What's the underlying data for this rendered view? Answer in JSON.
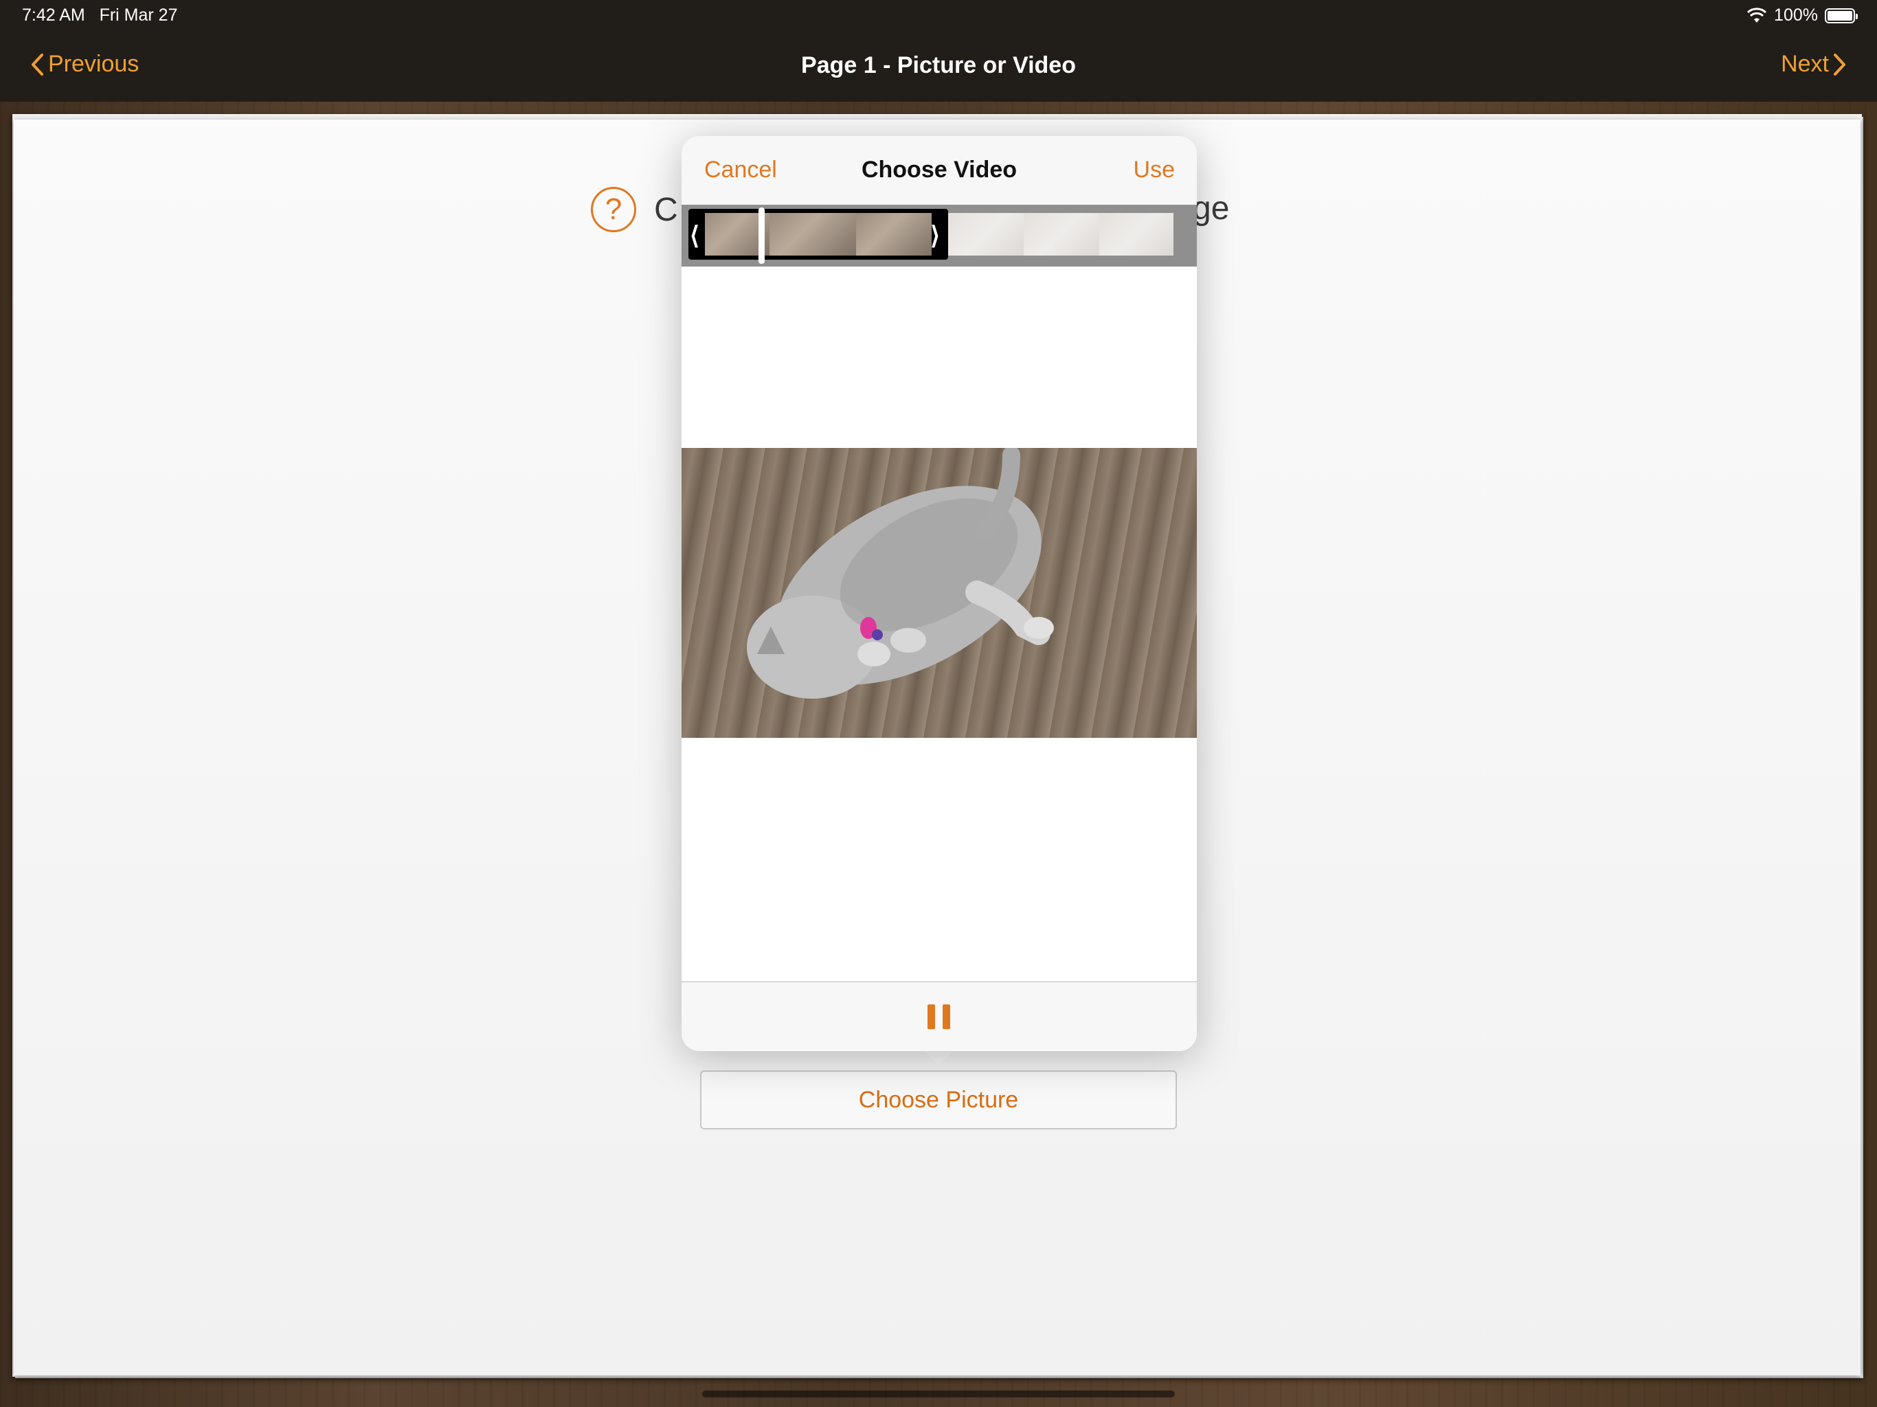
{
  "status_bar": {
    "time": "7:42 AM",
    "date": "Fri Mar 27",
    "battery": "100%"
  },
  "nav": {
    "previous_label": "Previous",
    "title": "Page 1 - Picture or Video",
    "next_label": "Next"
  },
  "page": {
    "help_text_start": "C",
    "help_text_end": "ge",
    "choose_picture_label": "Choose Picture"
  },
  "popover": {
    "cancel_label": "Cancel",
    "title": "Choose Video",
    "use_label": "Use"
  },
  "colors": {
    "accent": "#e07820",
    "nav_accent": "#f0a030",
    "topbar": "#211d19"
  },
  "icons": {
    "back": "chevron-left-icon",
    "forward": "chevron-right-icon",
    "help": "question-circle-icon",
    "pause": "pause-icon",
    "wifi": "wifi-icon",
    "battery": "battery-icon"
  }
}
